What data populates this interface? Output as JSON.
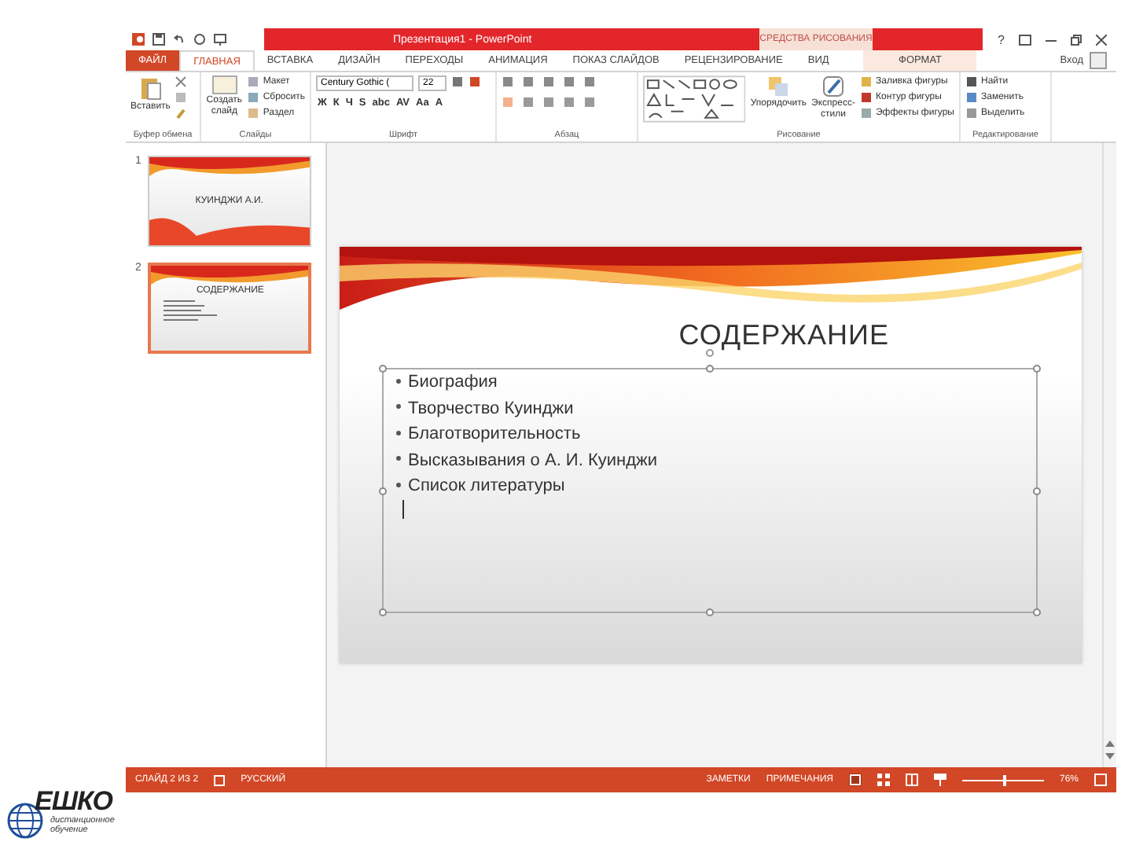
{
  "window": {
    "title": "Презентация1 - PowerPoint",
    "context_label": "СРЕДСТВА РИСОВАНИЯ",
    "help": "?",
    "signin": "Вход"
  },
  "tabs": [
    {
      "label": "ФАЙЛ",
      "kind": "file",
      "selected": false
    },
    {
      "label": "ГЛАВНАЯ",
      "kind": "normal",
      "selected": true
    },
    {
      "label": "ВСТАВКА",
      "kind": "normal",
      "selected": false
    },
    {
      "label": "ДИЗАЙН",
      "kind": "normal",
      "selected": false
    },
    {
      "label": "ПЕРЕХОДЫ",
      "kind": "normal",
      "selected": false
    },
    {
      "label": "АНИМАЦИЯ",
      "kind": "normal",
      "selected": false
    },
    {
      "label": "ПОКАЗ СЛАЙДОВ",
      "kind": "normal",
      "selected": false
    },
    {
      "label": "РЕЦЕНЗИРОВАНИЕ",
      "kind": "normal",
      "selected": false
    },
    {
      "label": "ВИД",
      "kind": "normal",
      "selected": false
    },
    {
      "label": "ФОРМАТ",
      "kind": "context",
      "selected": false
    }
  ],
  "ribbon": {
    "clipboard": {
      "label": "Буфер обмена",
      "paste": "Вставить"
    },
    "slides": {
      "label": "Слайды",
      "new_slide": "Создать слайд",
      "layout": "Макет",
      "reset": "Сбросить",
      "section": "Раздел"
    },
    "font": {
      "label": "Шрифт",
      "font_name": "Century Gothic (",
      "font_size": "22",
      "format_buttons": [
        "Ж",
        "К",
        "Ч",
        "S",
        "abc",
        "AV",
        "Aa",
        "A"
      ]
    },
    "paragraph": {
      "label": "Абзац"
    },
    "drawing": {
      "label": "Рисование",
      "arrange": "Упорядочить",
      "quick_styles": "Экспресс-стили",
      "fill": "Заливка фигуры",
      "outline": "Контур фигуры",
      "effects": "Эффекты фигуры"
    },
    "editing": {
      "label": "Редактирование",
      "find": "Найти",
      "replace": "Заменить",
      "select": "Выделить"
    }
  },
  "thumbnails": [
    {
      "number": "1",
      "title": "КУИНДЖИ А.И.",
      "selected": false
    },
    {
      "number": "2",
      "title": "СОДЕРЖАНИЕ",
      "selected": true
    }
  ],
  "slide": {
    "title": "СОДЕРЖАНИЕ",
    "bullets": [
      "Биография",
      "Творчество Куинджи",
      "Благотворительность",
      "Высказывания о А. И. Куинджи",
      "Список литературы"
    ]
  },
  "status_bar": {
    "slide": "СЛАЙД 2 ИЗ 2",
    "language": "РУССКИЙ",
    "notes": "ЗАМЕТКИ",
    "comments": "ПРИМЕЧАНИЯ",
    "zoom": "76%",
    "zoom_slider": {
      "level": 0.5
    }
  },
  "logo": {
    "name": "ЕШКО",
    "tagline": "дистанционное обучение"
  }
}
